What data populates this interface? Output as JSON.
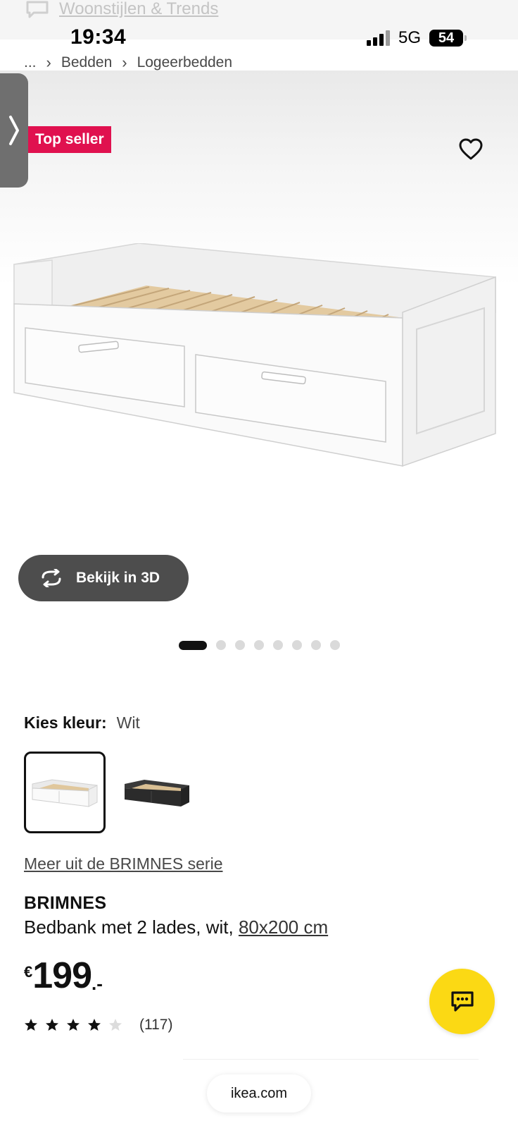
{
  "top_strip": {
    "link_text": "Woonstijlen & Trends"
  },
  "status_bar": {
    "time": "19:34",
    "network": "5G",
    "battery": "54"
  },
  "breadcrumb": {
    "ellipsis": "...",
    "items": [
      "Bedden",
      "Logeerbedden"
    ]
  },
  "badge": {
    "label": "Top seller",
    "color": "#e0114f"
  },
  "view_3d": {
    "label": "Bekijk in 3D"
  },
  "carousel": {
    "total": 8,
    "active": 1
  },
  "color_picker": {
    "label": "Kies kleur:",
    "selected": "Wit",
    "options": [
      {
        "name": "wit",
        "selected": true
      },
      {
        "name": "zwart",
        "selected": false
      }
    ]
  },
  "series_link": "Meer uit de BRIMNES serie",
  "product": {
    "name": "BRIMNES",
    "description": "Bedbank met 2 lades, wit, ",
    "size": "80x200 cm"
  },
  "price": {
    "currency": "€",
    "amount": "199",
    "decimal": ".-"
  },
  "rating": {
    "stars": 4,
    "max": 5,
    "count": "(117)"
  },
  "chat": {
    "color": "#fbd914"
  },
  "browser": {
    "url": "ikea.com"
  }
}
